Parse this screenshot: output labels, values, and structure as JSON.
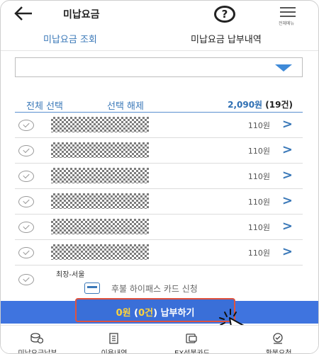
{
  "header": {
    "title": "미납요금",
    "help_label": "?",
    "menu_label": "전체메뉴"
  },
  "tabs": [
    {
      "label": "미납요금 조회"
    },
    {
      "label": "미납요금 납부내역"
    }
  ],
  "controls": {
    "select_all": "전체 선택",
    "deselect_all": "선택 해제",
    "total_amount": "2,090원",
    "total_count": "(19건)"
  },
  "items": [
    {
      "amount": "110원"
    },
    {
      "amount": "110원"
    },
    {
      "amount": "110원"
    },
    {
      "amount": "110원"
    },
    {
      "amount": "110원"
    },
    {
      "amount": "110원"
    }
  ],
  "partial_item": {
    "label": "최장-서울"
  },
  "hipass": {
    "label": "후불 하이패스 카드 신청"
  },
  "pay_button": {
    "amount": "0원",
    "count_open": "(",
    "count": "0건",
    "count_close": ")",
    "action": " 납부하기"
  },
  "bottom_nav": [
    {
      "label": "미납요금납부",
      "icon": "coins-icon"
    },
    {
      "label": "이용내역",
      "icon": "document-icon"
    },
    {
      "label": "EX선불카드",
      "icon": "card-icon"
    },
    {
      "label": "환불요청",
      "icon": "refund-icon"
    }
  ],
  "colors": {
    "accent": "#3a78b8",
    "pay_bar": "#3f74df",
    "highlight": "#ffd43a",
    "annotation": "#e0533f"
  }
}
